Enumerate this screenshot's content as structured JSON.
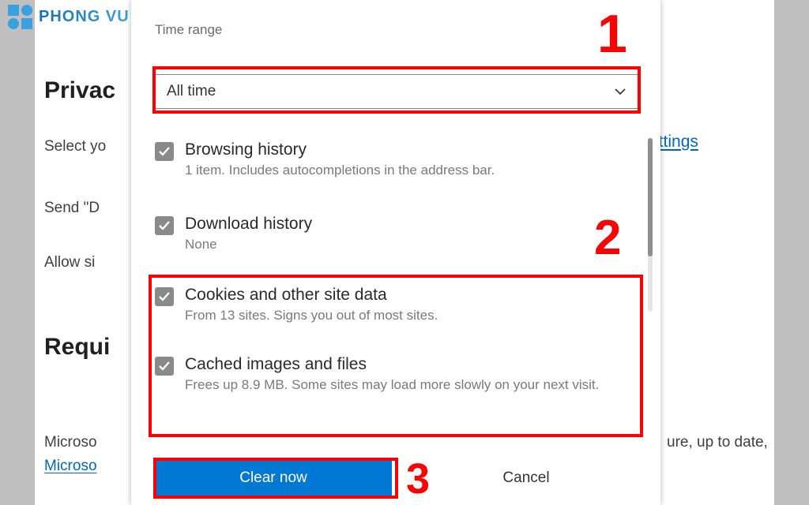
{
  "logo": {
    "text": "PHONG VU"
  },
  "background": {
    "heading1": "Privac",
    "line1": "Select yo",
    "line2": "Send \"D",
    "line3": "Allow si",
    "heading2": "Requi",
    "line4": "Microso",
    "link1": "Microso",
    "link2": "ettings",
    "line5": "ure, up to date,"
  },
  "dialog": {
    "time_range_label": "Time range",
    "time_range_value": "All time",
    "items": [
      {
        "title": "Browsing history",
        "sub": "1 item. Includes autocompletions in the address bar."
      },
      {
        "title": "Download history",
        "sub": "None"
      },
      {
        "title": "Cookies and other site data",
        "sub": "From 13 sites. Signs you out of most sites."
      },
      {
        "title": "Cached images and files",
        "sub": "Frees up 8.9 MB. Some sites may load more slowly on your next visit."
      }
    ],
    "primary_button": "Clear now",
    "secondary_button": "Cancel"
  },
  "annotations": {
    "n1": "1",
    "n2": "2",
    "n3": "3"
  }
}
